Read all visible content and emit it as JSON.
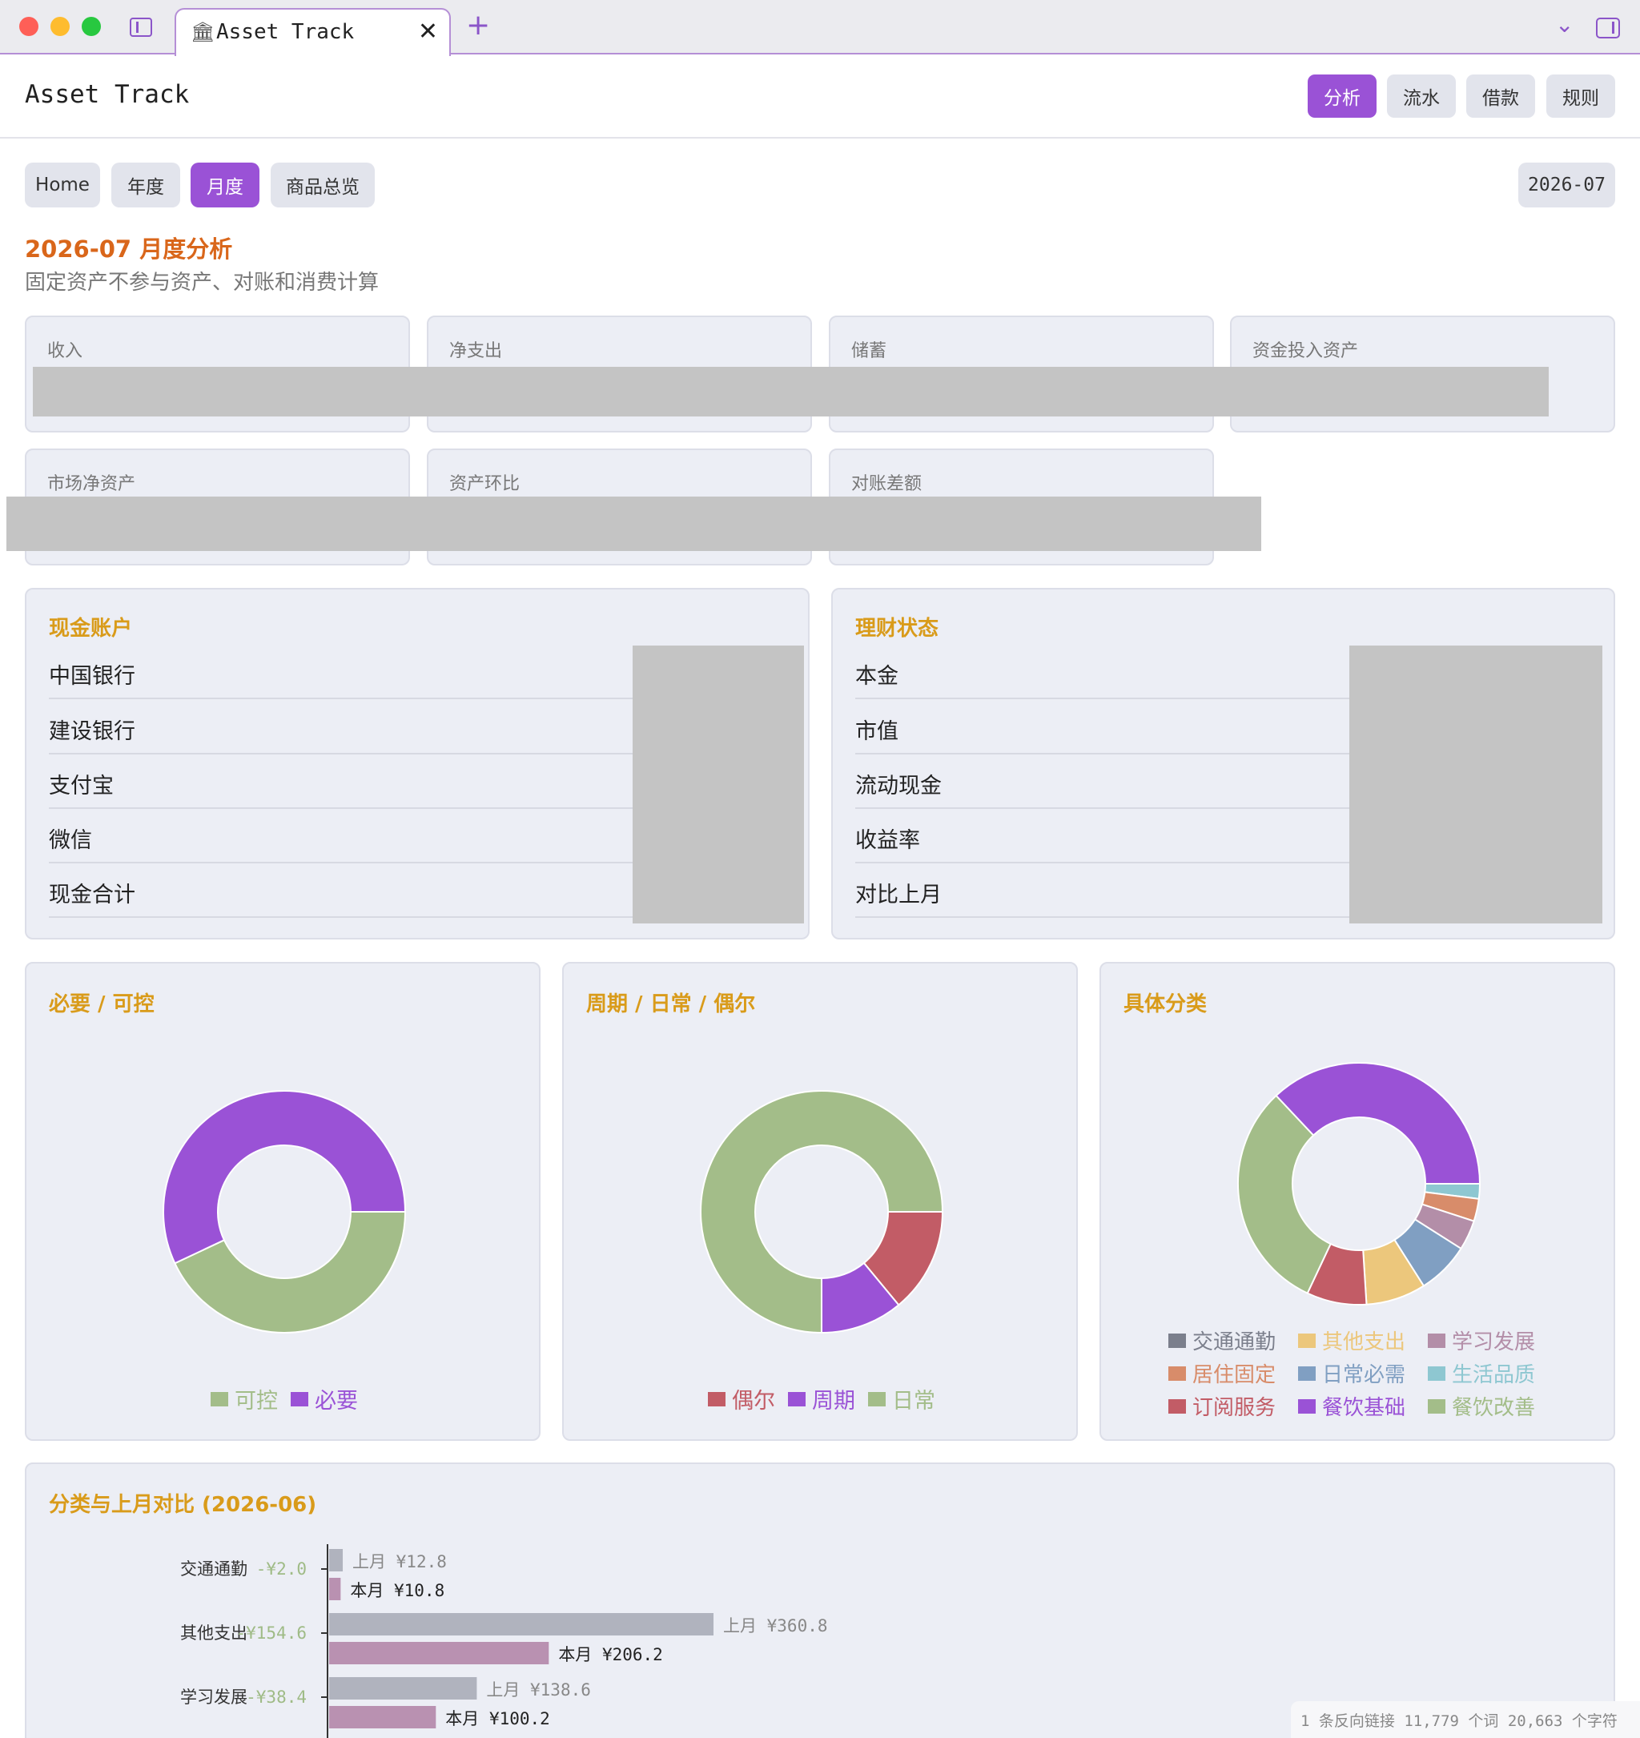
{
  "window": {
    "tab_title": "Asset Track",
    "tab_icon": "bank-icon",
    "tab_close": "✕",
    "new_tab": "+",
    "chevron": "⌄"
  },
  "header": {
    "app_title": "Asset Track",
    "nav": [
      "分析",
      "流水",
      "借款",
      "规则"
    ],
    "active_nav": "分析"
  },
  "subnav": {
    "items": [
      "Home",
      "年度",
      "月度",
      "商品总览"
    ],
    "active": "月度",
    "month": "2026-07"
  },
  "page": {
    "title": "2026-07  月度分析",
    "subtitle": "固定资产不参与资产、对账和消费计算"
  },
  "stats": {
    "row1": [
      "收入",
      "净支出",
      "储蓄",
      "资金投入资产"
    ],
    "row2": [
      "市场净资产",
      "资产环比",
      "对账差额"
    ]
  },
  "cash": {
    "title": "现金账户",
    "rows": [
      "中国银行",
      "建设银行",
      "支付宝",
      "微信",
      "现金合计"
    ]
  },
  "invest": {
    "title": "理财状态",
    "rows": [
      "本金",
      "市值",
      "流动现金",
      "收益率",
      "对比上月"
    ]
  },
  "colors": {
    "purple": "#9a52d6",
    "green": "#a3bd89",
    "red": "#c25c66",
    "gray": "#7b7f8c",
    "yellow": "#ecc77c",
    "mauve": "#b38ea8",
    "orange": "#d88c6a",
    "blue": "#809fc2",
    "teal": "#8ec7d1"
  },
  "chart_data": [
    {
      "type": "pie",
      "title": "必要 / 可控",
      "series": [
        {
          "name": "可控",
          "value": 43,
          "color": "#a3bd89"
        },
        {
          "name": "必要",
          "value": 57,
          "color": "#9a52d6"
        }
      ],
      "legend": "bottom"
    },
    {
      "type": "pie",
      "title": "周期 / 日常 / 偶尔",
      "series": [
        {
          "name": "偶尔",
          "value": 14,
          "color": "#c25c66"
        },
        {
          "name": "周期",
          "value": 11,
          "color": "#9a52d6"
        },
        {
          "name": "日常",
          "value": 75,
          "color": "#a3bd89"
        }
      ],
      "legend": "bottom"
    },
    {
      "type": "pie",
      "title": "具体分类",
      "series": [
        {
          "name": "交通通勤",
          "value": 0,
          "color": "#7b7f8c"
        },
        {
          "name": "其他支出",
          "value": 8,
          "color": "#ecc77c"
        },
        {
          "name": "学习发展",
          "value": 4,
          "color": "#b38ea8"
        },
        {
          "name": "居住固定",
          "value": 3,
          "color": "#d88c6a"
        },
        {
          "name": "日常必需",
          "value": 7,
          "color": "#809fc2"
        },
        {
          "name": "生活品质",
          "value": 2,
          "color": "#8ec7d1"
        },
        {
          "name": "订阅服务",
          "value": 8,
          "color": "#c25c66"
        },
        {
          "name": "餐饮基础",
          "value": 37,
          "color": "#9a52d6"
        },
        {
          "name": "餐饮改善",
          "value": 31,
          "color": "#a3bd89"
        }
      ],
      "legend": "bottom"
    },
    {
      "type": "bar",
      "title": "分类与上月对比 (2026-06)",
      "categories": [
        "交通通勤",
        "其他支出",
        "学习发展"
      ],
      "diffs": [
        "-¥2.0",
        "-¥154.6",
        "-¥38.4"
      ],
      "series": [
        {
          "name": "上月",
          "values": [
            12.8,
            360.8,
            138.6
          ],
          "color": "#b0b3be"
        },
        {
          "name": "本月",
          "values": [
            10.8,
            206.2,
            100.2
          ],
          "color": "#b991b1"
        }
      ],
      "labels": {
        "prev": [
          "上月 ¥12.8",
          "上月 ¥360.8",
          "上月 ¥138.6"
        ],
        "curr": [
          "本月 ¥10.8",
          "本月 ¥206.2",
          "本月 ¥100.2"
        ]
      }
    }
  ],
  "statusbar": {
    "text": "1 条反向链接  11,779 个词  20,663 个字符"
  }
}
